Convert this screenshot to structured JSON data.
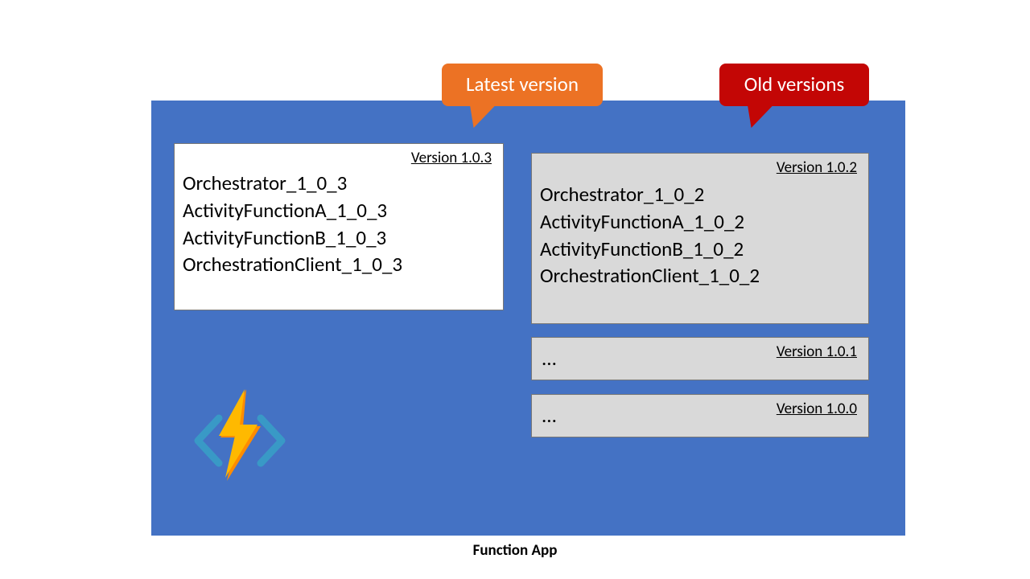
{
  "callouts": {
    "latest": "Latest version",
    "old": "Old versions"
  },
  "caption": "Function App",
  "cards": {
    "latest": {
      "version_label": "Version 1.0.3",
      "functions": [
        "Orchestrator_1_0_3",
        "ActivityFunctionA_1_0_3",
        "ActivityFunctionB_1_0_3",
        "OrchestrationClient_1_0_3"
      ]
    },
    "old_expanded": {
      "version_label": "Version 1.0.2",
      "functions": [
        "Orchestrator_1_0_2",
        "ActivityFunctionA_1_0_2",
        "ActivityFunctionB_1_0_2",
        "OrchestrationClient_1_0_2"
      ]
    },
    "old_collapsed_1": {
      "version_label": "Version 1.0.1",
      "ellipsis": "..."
    },
    "old_collapsed_2": {
      "version_label": "Version 1.0.0",
      "ellipsis": "..."
    }
  },
  "colors": {
    "container": "#4472c4",
    "latest_callout": "#ec7224",
    "old_callout": "#c30605",
    "grey_card": "#d9d9d9"
  },
  "logo": {
    "name": "azure-functions-icon",
    "bolt_color": "#ffb900",
    "bolt_shadow": "#ff8c00",
    "bracket_color": "#3999c6"
  }
}
